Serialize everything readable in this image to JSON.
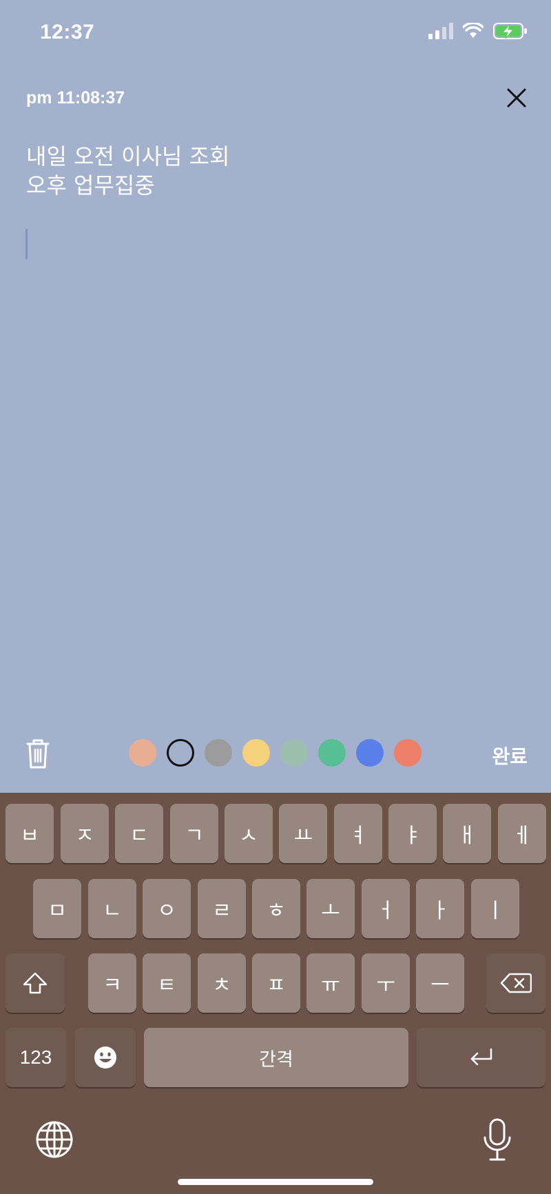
{
  "status_bar": {
    "time": "12:37",
    "icons": [
      "signal-icon",
      "wifi-icon",
      "battery-charging-icon"
    ]
  },
  "note": {
    "timestamp": "pm 11:08:37",
    "lines": [
      "내일 오전 이사님 조회",
      "오후 업무집중"
    ]
  },
  "toolbar": {
    "done_label": "완료",
    "colors": [
      "#e8ae94",
      "none",
      "#9c9c9c",
      "#f4d17a",
      "#9cbfad",
      "#57bf93",
      "#5b7fe8",
      "#ee8069"
    ],
    "selected_color_index": 1
  },
  "keyboard": {
    "row1": [
      "ㅂ",
      "ㅈ",
      "ㄷ",
      "ㄱ",
      "ㅅ",
      "ㅛ",
      "ㅕ",
      "ㅑ",
      "ㅐ",
      "ㅔ"
    ],
    "row2": [
      "ㅁ",
      "ㄴ",
      "ㅇ",
      "ㄹ",
      "ㅎ",
      "ㅗ",
      "ㅓ",
      "ㅏ",
      "ㅣ"
    ],
    "row3": [
      "ㅋ",
      "ㅌ",
      "ㅊ",
      "ㅍ",
      "ㅠ",
      "ㅜ",
      "ㅡ"
    ],
    "numbers_label": "123",
    "space_label": "간격"
  }
}
